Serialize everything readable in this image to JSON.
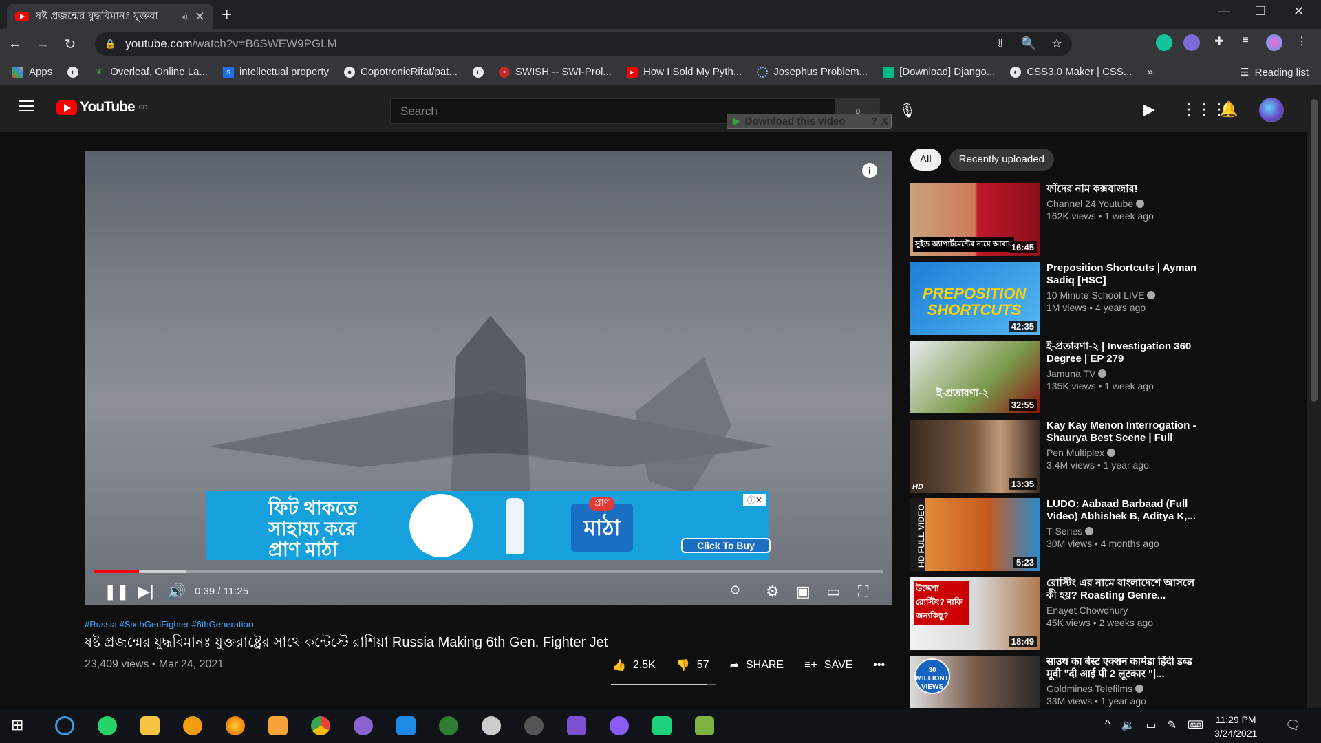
{
  "browser": {
    "tab_title": "ষষ্ট প্রজন্মের যুদ্ধবিমানঃ যুক্তরা",
    "url_host": "youtube.com",
    "url_path": "/watch?v=B6SWEW9PGLM",
    "newtab": "+",
    "tab_close": "✕"
  },
  "bookmarks": [
    {
      "label": "Apps",
      "icon": "apps-icon"
    },
    {
      "label": "",
      "icon": "globe-icon"
    },
    {
      "label": "Overleaf, Online La...",
      "icon": "overleaf-icon"
    },
    {
      "label": "intellectual property",
      "icon": "s-icon"
    },
    {
      "label": "CopotronicRifat/pat...",
      "icon": "github-icon"
    },
    {
      "label": "",
      "icon": "globe-icon"
    },
    {
      "label": "SWISH -- SWI-Prol...",
      "icon": "swish-icon"
    },
    {
      "label": "How I Sold My Pyth...",
      "icon": "youtube-icon"
    },
    {
      "label": "Josephus Problem...",
      "icon": "spinner-icon"
    },
    {
      "label": "[Download] Django...",
      "icon": "django-icon"
    },
    {
      "label": "CSS3.0 Maker | CSS...",
      "icon": "globe-icon"
    }
  ],
  "bookmarks_more": "»",
  "reading_list": "Reading list",
  "youtube": {
    "logo_text": "YouTube",
    "region": "BD",
    "search_placeholder": "Search",
    "download_bar": "Download this video",
    "download_help": "?",
    "download_close": "X"
  },
  "player": {
    "info": "i",
    "time": "0:39 / 11:25",
    "ad": {
      "line1": "ফিট থাকতে",
      "line2": "সাহায্য করে",
      "line3": "প্রাণ মাঠা",
      "brand": "মাঠা",
      "brand_top": "প্রাণ",
      "cta": "Click To Buy",
      "close": "ⓘ✕"
    },
    "progress_played": 0.057,
    "progress_buffered": 0.117
  },
  "video": {
    "tags": "#Russia #SixthGenFighter #6thGeneration",
    "title": "ষষ্ট প্রজন্মের যুদ্ধবিমানঃ যুক্তরাষ্ট্রের সাথে কন্টেস্টে রাশিয়া Russia Making 6th Gen. Fighter Jet",
    "views": "23,409 views • Mar 24, 2021",
    "likes": "2.5K",
    "dislikes": "57",
    "share": "SHARE",
    "save": "SAVE",
    "more": "•••",
    "like_ratio": 0.92
  },
  "chips": [
    "All",
    "Recently uploaded"
  ],
  "recommendations": [
    {
      "title": "ফাঁদের নাম কক্সবাজার!",
      "channel": "Channel 24 Youtube",
      "meta": "162K views • 1 week ago",
      "duration": "16:45",
      "thumb_caption": "সুইড অ্যাপার্টমেন্টের নামে আবার"
    },
    {
      "title": "Preposition Shortcuts | Ayman Sadiq [HSC]",
      "channel": "10 Minute School LIVE",
      "meta": "1M views • 4 years ago",
      "duration": "42:35",
      "thumb_caption": "PREPOSITION SHORTCUTS"
    },
    {
      "title": "ই-প্রতারণা-২ | Investigation 360 Degree | EP 279",
      "channel": "Jamuna TV",
      "meta": "135K views • 1 week ago",
      "duration": "32:55",
      "thumb_caption": "ই-প্রতারণা-২"
    },
    {
      "title": "Kay Kay Menon Interrogation - Shaurya Best Scene | Full Hind...",
      "channel": "Pen Multiplex",
      "meta": "3.4M views • 1 year ago",
      "duration": "13:35",
      "thumb_caption": "HD"
    },
    {
      "title": "LUDO: Aabaad Barbaad (Full Video) Abhishek B, Aditya K,...",
      "channel": "T-Series",
      "meta": "30M views • 4 months ago",
      "duration": "5:23",
      "thumb_caption": "HD FULL VIDEO"
    },
    {
      "title": "রোস্টিং এর নামে বাংলাদেশে আসলে কী হয়? Roasting Genre...",
      "channel": "Enayet Chowdhury",
      "meta": "45K views • 2 weeks ago",
      "duration": "18:49",
      "thumb_caption": "উদ্দেশ্য রোস্টিং? নাকি অন্যকিছু?"
    },
    {
      "title": "साउथ का बेस्ट एक्शन कामेडा हिंदी डब्ड मूवी \"दी आई पी 2 लूटकार \"|...",
      "channel": "Goldmines Telefilms",
      "meta": "33M views • 1 year ago",
      "duration": "",
      "thumb_caption": "30 MILLION+ VIEWS"
    }
  ],
  "taskbar": {
    "time": "11:29 PM",
    "date": "3/24/2021"
  },
  "colors": {
    "accent": "#ff0000",
    "link": "#3ea6ff",
    "bg": "#0f0f0f",
    "header": "#202020"
  }
}
